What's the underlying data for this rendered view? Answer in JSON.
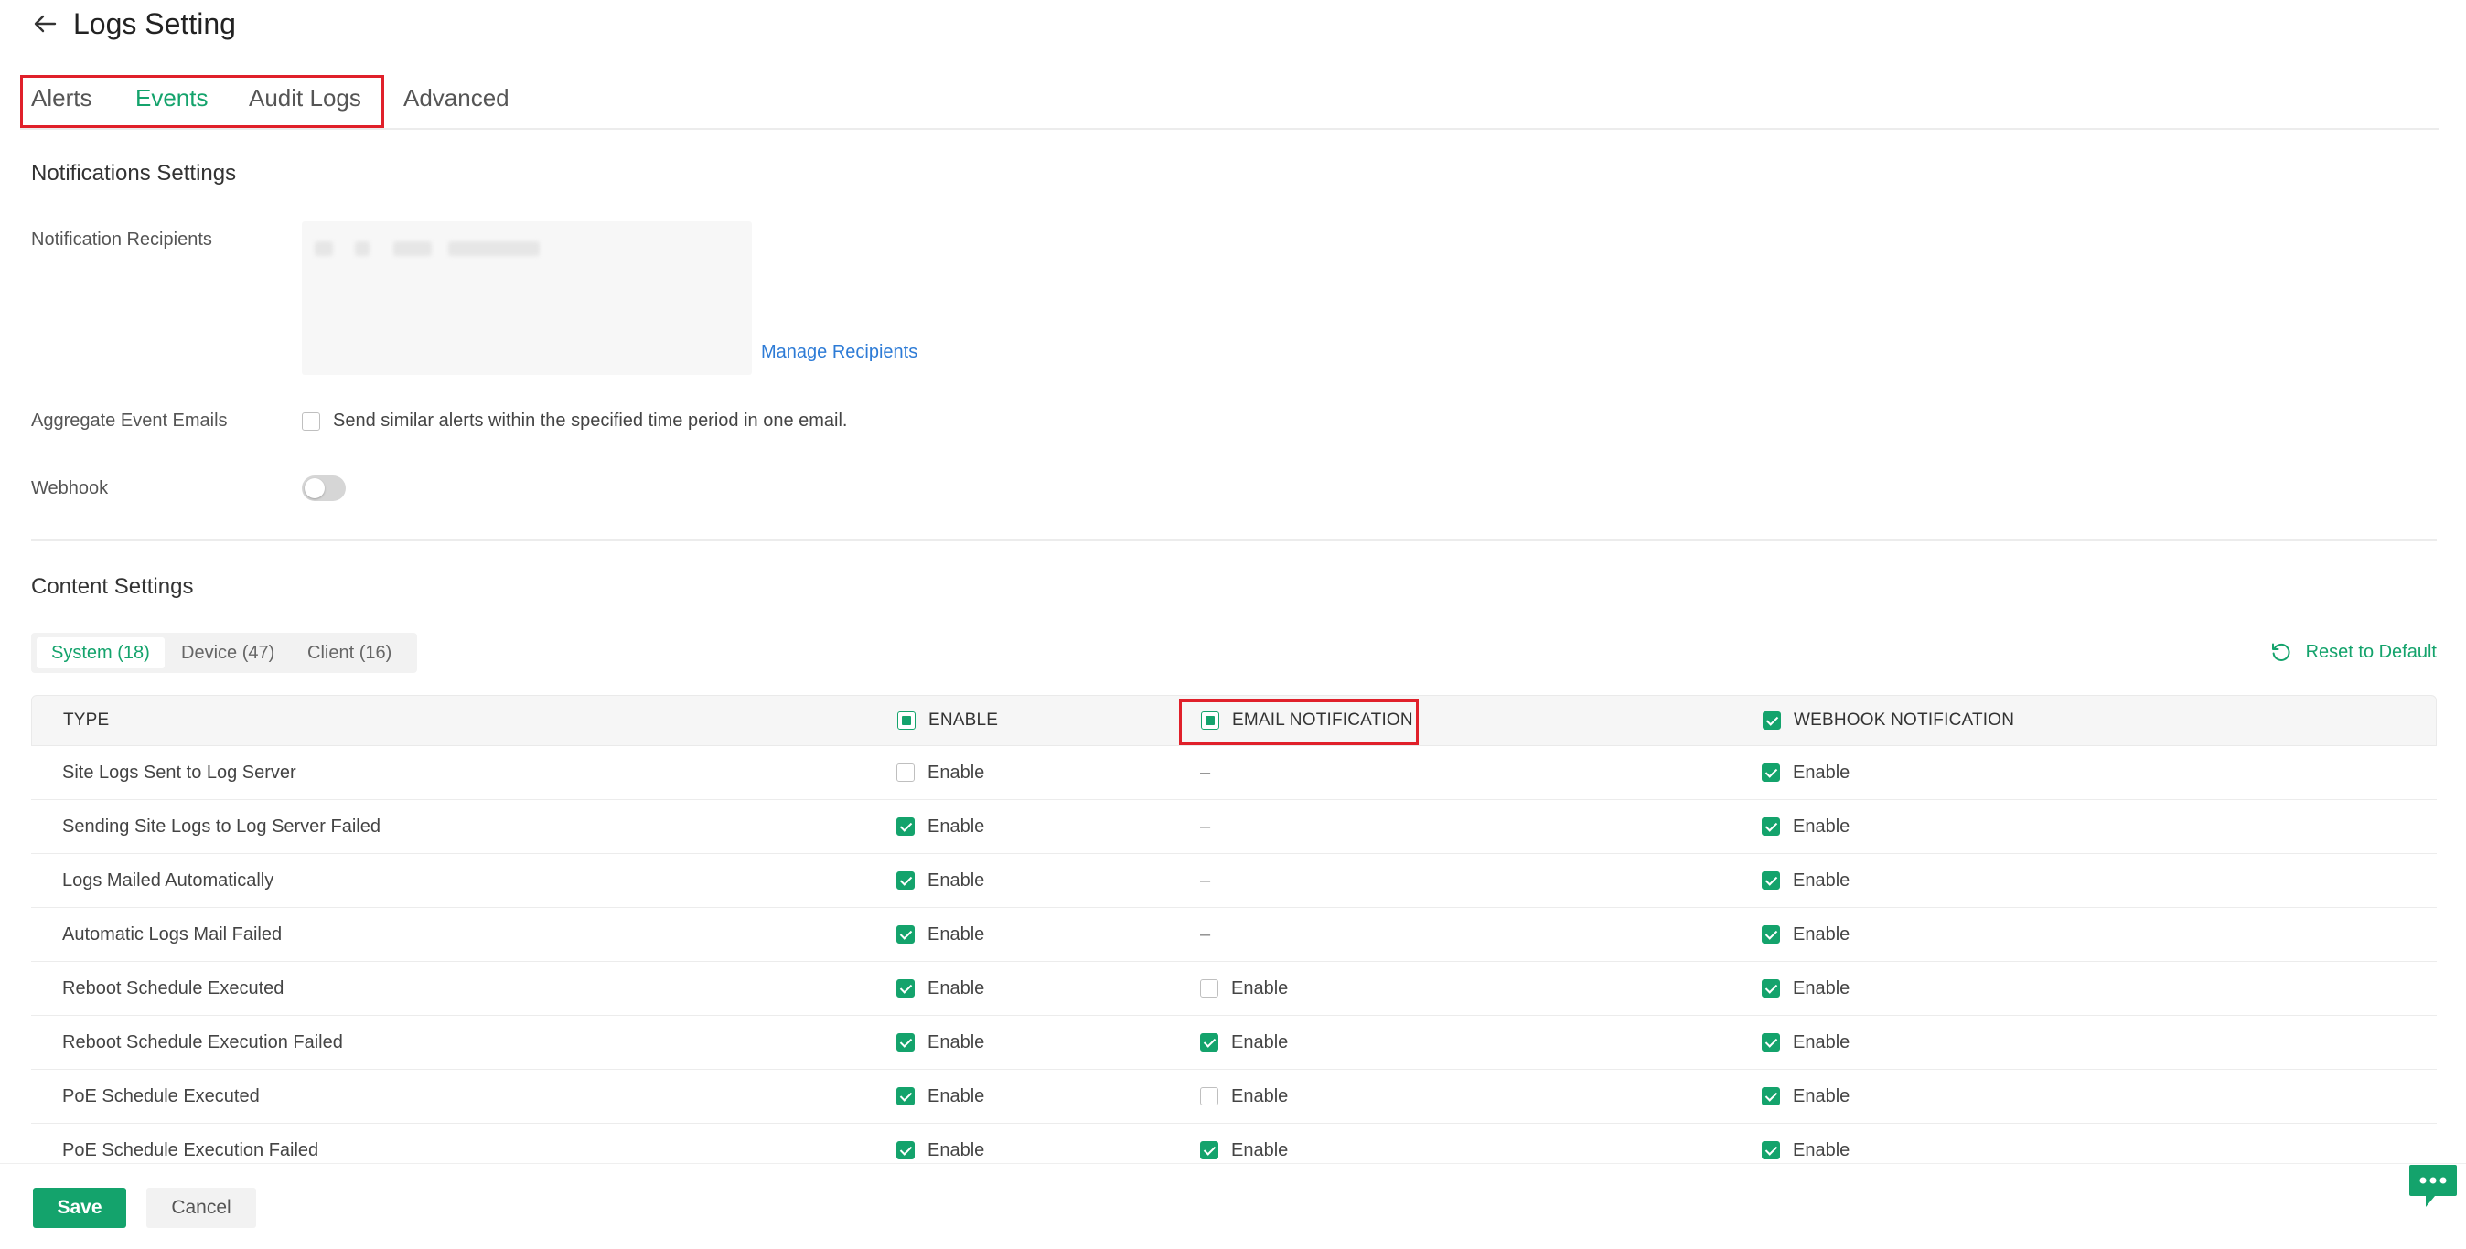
{
  "header": {
    "title": "Logs Setting",
    "back_icon": "arrow-left-icon"
  },
  "main_tabs": [
    {
      "label": "Alerts"
    },
    {
      "label": "Events",
      "active": true
    },
    {
      "label": "Audit Logs"
    },
    {
      "label": "Advanced"
    }
  ],
  "notifications": {
    "title": "Notifications Settings",
    "recipients_label": "Notification Recipients",
    "manage_recipients": "Manage Recipients",
    "aggregate_label": "Aggregate Event Emails",
    "aggregate_text": "Send similar alerts within the specified time period in one email.",
    "aggregate_checked": false,
    "webhook_label": "Webhook",
    "webhook_on": false
  },
  "content": {
    "title": "Content Settings",
    "sub_tabs": [
      {
        "label": "System (18)",
        "active": true
      },
      {
        "label": "Device (47)"
      },
      {
        "label": "Client (16)"
      }
    ],
    "reset_label": "Reset to Default",
    "table": {
      "headers": {
        "type": "TYPE",
        "enable": "ENABLE",
        "email": "EMAIL NOTIFICATION",
        "webhook": "WEBHOOK NOTIFICATION"
      },
      "header_states": {
        "enable": "partial",
        "email": "partial",
        "webhook": "checked"
      },
      "enable_text": "Enable",
      "dash": "–",
      "rows": [
        {
          "type": "Site Logs Sent to Log Server",
          "enable": false,
          "email": null,
          "webhook": true
        },
        {
          "type": "Sending Site Logs to Log Server Failed",
          "enable": true,
          "email": null,
          "webhook": true
        },
        {
          "type": "Logs Mailed Automatically",
          "enable": true,
          "email": null,
          "webhook": true
        },
        {
          "type": "Automatic Logs Mail Failed",
          "enable": true,
          "email": null,
          "webhook": true
        },
        {
          "type": "Reboot Schedule Executed",
          "enable": true,
          "email": false,
          "webhook": true
        },
        {
          "type": "Reboot Schedule Execution Failed",
          "enable": true,
          "email": true,
          "webhook": true
        },
        {
          "type": "PoE Schedule Executed",
          "enable": true,
          "email": false,
          "webhook": true
        },
        {
          "type": "PoE Schedule Execution Failed",
          "enable": true,
          "email": true,
          "webhook": true
        }
      ]
    }
  },
  "footer": {
    "save": "Save",
    "cancel": "Cancel"
  },
  "colors": {
    "accent": "#14a36c",
    "link": "#2d7bd6",
    "highlight": "#e0202a"
  }
}
